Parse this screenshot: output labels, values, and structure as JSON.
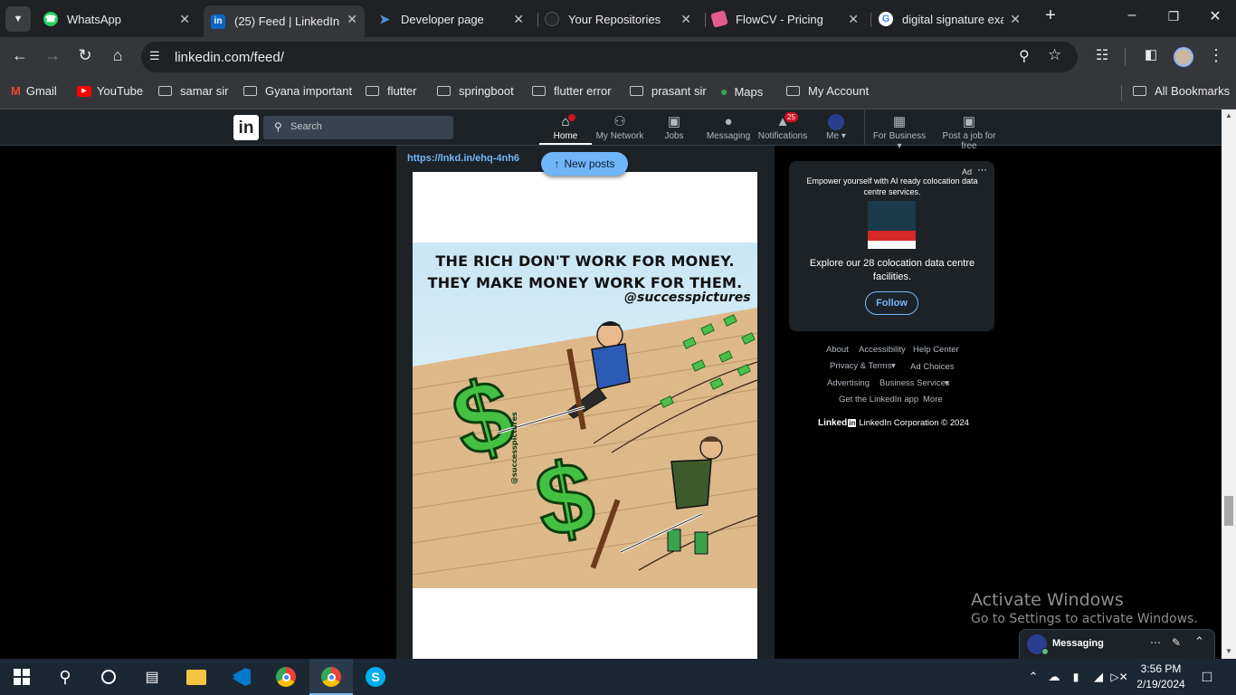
{
  "tabs": [
    {
      "title": "WhatsApp",
      "icon": "whatsapp-icon",
      "color": "#25d366"
    },
    {
      "title": "(25) Feed | LinkedIn",
      "icon": "linkedin-icon",
      "color": "#0a66c2"
    },
    {
      "title": "Developer page",
      "icon": "flutter-icon",
      "color": "#4e8fdc"
    },
    {
      "title": "Your Repositories",
      "icon": "github-icon",
      "color": "#333333"
    },
    {
      "title": "FlowCV - Pricing",
      "icon": "flowcv-icon",
      "color": "#e35b8a"
    },
    {
      "title": "digital signature exam",
      "icon": "google-icon",
      "color": "#4285f4"
    }
  ],
  "address": {
    "url": "linkedin.com/feed/"
  },
  "bookmarks": [
    "Gmail",
    "YouTube",
    "samar sir",
    "Gyana important",
    "flutter",
    "springboot",
    "flutter error",
    "prasant sir",
    "Maps",
    "My Account",
    "All Bookmarks"
  ],
  "linkedin": {
    "search_placeholder": "Search",
    "nav": [
      "Home",
      "My Network",
      "Jobs",
      "Messaging",
      "Notifications",
      "Me",
      "For Business",
      "Post a job for free"
    ],
    "notifications_badge": "25"
  },
  "feed": {
    "link": "https://lnkd.in/ehq-4nh6",
    "new_posts": "New posts",
    "image_line1": "THE RICH DON'T WORK FOR MONEY.",
    "image_line2": "THEY MAKE MONEY WORK FOR THEM.",
    "image_credit": "@successpictures",
    "image_side_credit": "@successpictures"
  },
  "ad": {
    "label": "Ad",
    "headline": "Empower yourself with AI ready colocation data centre services.",
    "body": "Explore our 28 colocation data centre facilities.",
    "follow": "Follow"
  },
  "footer": {
    "links": [
      "About",
      "Accessibility",
      "Help Center",
      "Privacy & Terms",
      "Ad Choices",
      "Advertising",
      "Business Services",
      "Get the LinkedIn app",
      "More"
    ],
    "brand": "Linked",
    "brand_in": "in",
    "copyright": "LinkedIn Corporation © 2024"
  },
  "messaging": {
    "label": "Messaging"
  },
  "watermark": {
    "line1": "Activate Windows",
    "line2": "Go to Settings to activate Windows."
  },
  "taskbar": {
    "time": "3:56 PM",
    "date": "2/19/2024"
  }
}
